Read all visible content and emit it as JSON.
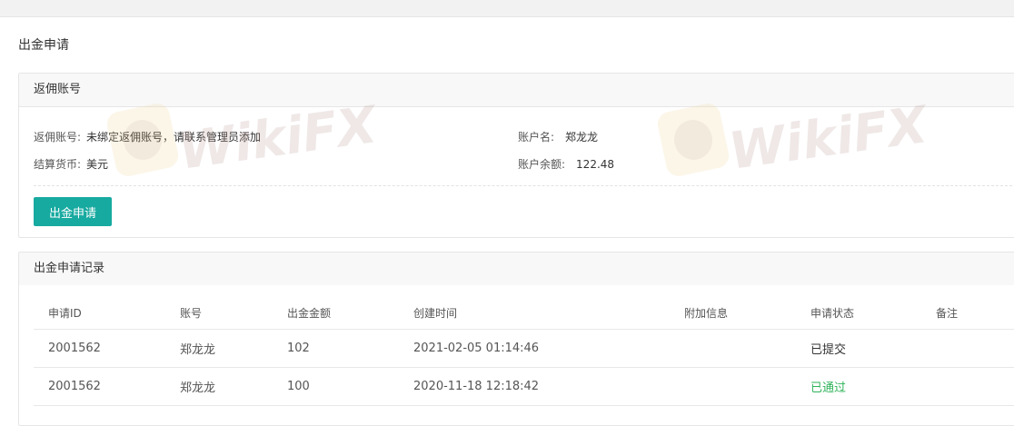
{
  "page": {
    "title": "出金申请"
  },
  "account_panel": {
    "title": "返佣账号",
    "rebate_account_label": "返佣账号:",
    "rebate_account_value": "未绑定返佣账号，请联系管理员添加",
    "currency_label": "结算货币:",
    "currency_value": "美元",
    "account_name_label": "账户名:",
    "account_name_value": "郑龙龙",
    "balance_label": "账户余额:",
    "balance_value": "122.48",
    "withdraw_button": "出金申请"
  },
  "records_panel": {
    "title": "出金申请记录",
    "columns": [
      "申请ID",
      "账号",
      "出金金额",
      "创建时间",
      "附加信息",
      "申请状态",
      "备注"
    ],
    "rows": [
      {
        "id": "2001562",
        "account": "郑龙龙",
        "amount": "102",
        "created": "2021-02-05 01:14:46",
        "extra": "",
        "status": "已提交",
        "note": ""
      },
      {
        "id": "2001562",
        "account": "郑龙龙",
        "amount": "100",
        "created": "2020-11-18 12:18:42",
        "extra": "",
        "status": "已通过",
        "note": ""
      }
    ]
  },
  "watermark": {
    "text": "WikiFX"
  },
  "colors": {
    "primary_button": "#17aaa0",
    "status_approved": "#2fb35a"
  }
}
